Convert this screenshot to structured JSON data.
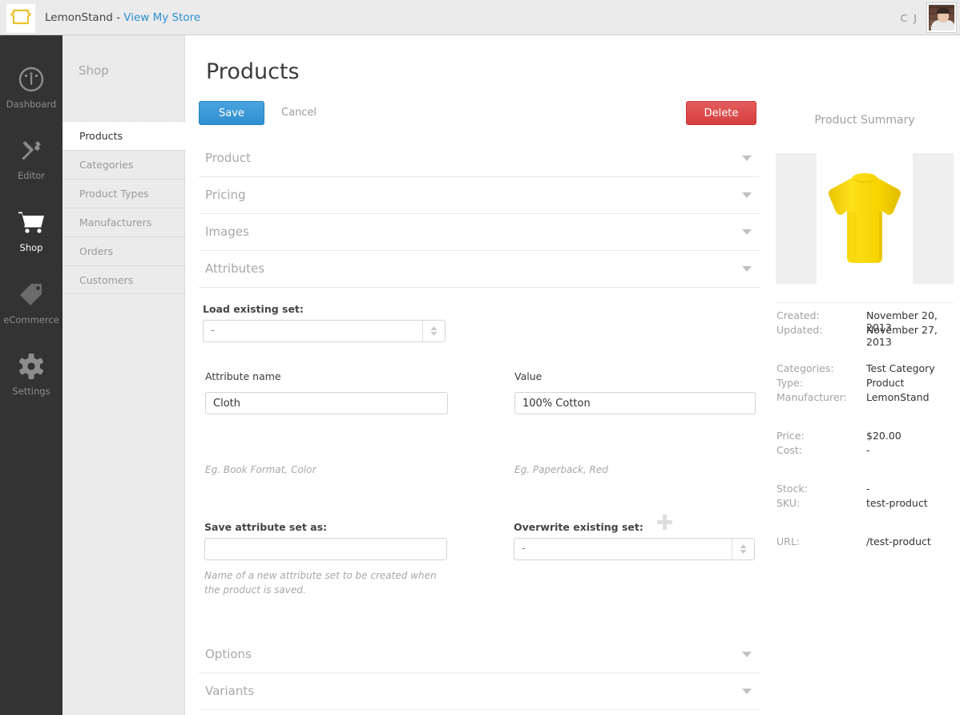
{
  "topbar": {
    "logo_icon": "lemonstand-logo-icon",
    "brand_name": "LemonStand - ",
    "store_link": "View My Store",
    "user_initials": "C J",
    "avatar_icon": "user-avatar-photo"
  },
  "rail": {
    "items": [
      {
        "label": "Dashboard",
        "icon": "gauge-icon",
        "active": false
      },
      {
        "label": "Editor",
        "icon": "tools-icon",
        "active": false
      },
      {
        "label": "Shop",
        "icon": "cart-icon",
        "active": true
      },
      {
        "label": "eCommerce",
        "icon": "tag-icon",
        "active": false
      },
      {
        "label": "Settings",
        "icon": "gear-icon",
        "active": false
      }
    ]
  },
  "subnav": {
    "title": "Shop",
    "items": [
      {
        "label": "Products",
        "active": true
      },
      {
        "label": "Categories",
        "active": false
      },
      {
        "label": "Product Types",
        "active": false
      },
      {
        "label": "Manufacturers",
        "active": false
      },
      {
        "label": "Orders",
        "active": false
      },
      {
        "label": "Customers",
        "active": false
      }
    ]
  },
  "main": {
    "page_title": "Products",
    "save_label": "Save",
    "cancel_label": "Cancel",
    "delete_label": "Delete",
    "sections": [
      {
        "label": "Product"
      },
      {
        "label": "Pricing"
      },
      {
        "label": "Images"
      },
      {
        "label": "Attributes"
      },
      {
        "label": "Options"
      },
      {
        "label": "Variants"
      }
    ],
    "load_existing_set": {
      "label": "Load existing set:",
      "value": "-"
    },
    "attribute_name": {
      "label": "Attribute name",
      "value": "Cloth",
      "hint": "Eg. Book Format, Color"
    },
    "attribute_value": {
      "label": "Value",
      "value": "100% Cotton",
      "hint": "Eg. Paperback, Red"
    },
    "add_attribute_icon": "plus-icon",
    "save_attribute_set": {
      "label": "Save attribute set as:",
      "value": "",
      "placeholder": "",
      "hint": "Name of a new attribute set to be created when the product is saved."
    },
    "overwrite_existing_set": {
      "label": "Overwrite existing set:",
      "value": "-"
    }
  },
  "summary": {
    "title": "Product Summary",
    "product_image": "yellow-tshirt-photo",
    "rows": [
      {
        "key": "Created:",
        "value": "November 20, 2013"
      },
      {
        "key": "Updated:",
        "value": "November 27, 2013"
      },
      {
        "key": "Categories:",
        "value": "Test Category"
      },
      {
        "key": "Type:",
        "value": "Product"
      },
      {
        "key": "Manufacturer:",
        "value": "LemonStand"
      },
      {
        "key": "Price:",
        "value": "$20.00"
      },
      {
        "key": "Cost:",
        "value": "-"
      },
      {
        "key": "Stock:",
        "value": "-"
      },
      {
        "key": "SKU:",
        "value": "test-product"
      },
      {
        "key": "URL:",
        "value": "/test-product"
      }
    ]
  },
  "colors": {
    "brand_yellow": "#e8c22e",
    "link_blue": "#2a8fd0",
    "save_blue": "#2f8fd0",
    "delete_red": "#d63f3f",
    "rail_dark": "#333333",
    "sidebar_gray": "#ebebeb",
    "tshirt_yellow": "#f5d400"
  }
}
